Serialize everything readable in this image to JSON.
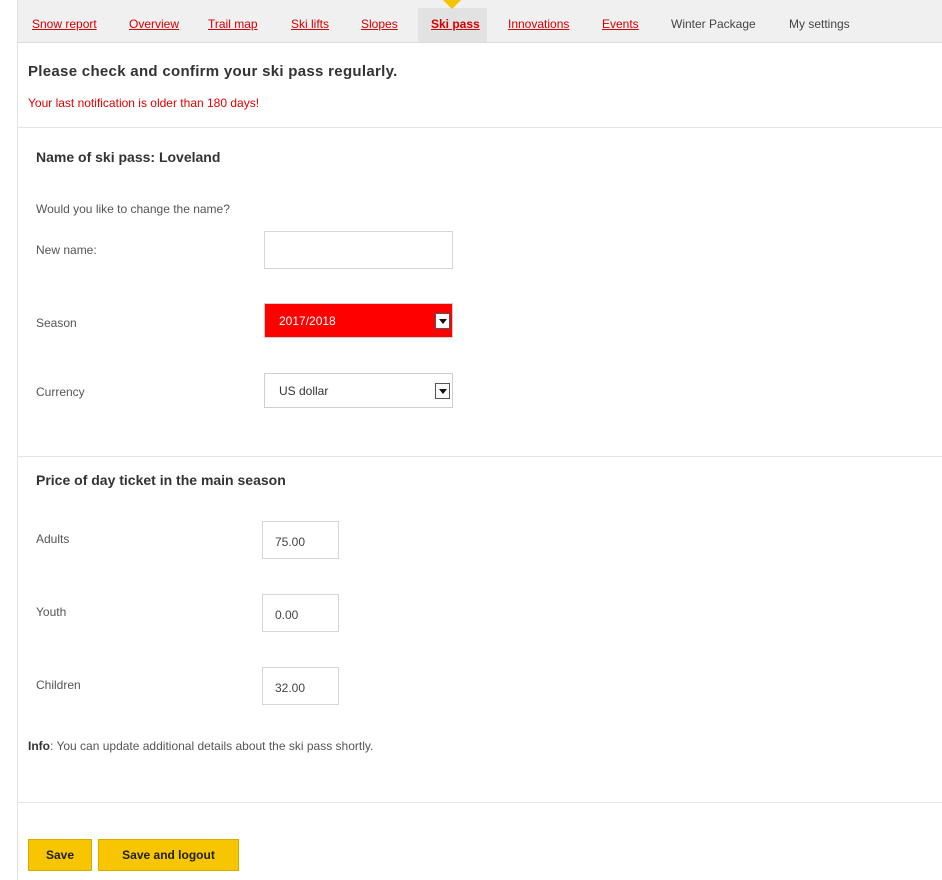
{
  "nav": {
    "tabs": [
      {
        "label": "Snow report"
      },
      {
        "label": "Overview"
      },
      {
        "label": "Trail map"
      },
      {
        "label": "Ski lifts"
      },
      {
        "label": "Slopes"
      },
      {
        "label": "Ski pass"
      },
      {
        "label": "Innovations"
      },
      {
        "label": "Events"
      },
      {
        "label": "Winter Package"
      },
      {
        "label": "My settings"
      }
    ],
    "active": "Ski pass"
  },
  "page": {
    "heading": "Please check and confirm your ski pass regularly.",
    "warning": "Your last notification is older than 180 days!"
  },
  "pass_section": {
    "title": "Name of ski pass: Loveland",
    "change_prompt": "Would you like to change the name?",
    "new_name_label": "New name:",
    "new_name_value": "",
    "season_label": "Season",
    "season_value": "2017/2018",
    "currency_label": "Currency",
    "currency_value": "US dollar"
  },
  "price_section": {
    "title": "Price of day ticket in the main season",
    "adults_label": "Adults",
    "adults_value": "75.00",
    "youth_label": "Youth",
    "youth_value": "0.00",
    "children_label": "Children",
    "children_value": "32.00"
  },
  "info": {
    "prefix": "Info",
    "text": ": You can update additional details about the ski pass shortly."
  },
  "actions": {
    "save_label": "Save",
    "save_logout_label": "Save and logout"
  },
  "colors": {
    "accent": "#f7c600",
    "link": "#d40000",
    "season_bg": "#ff0000"
  }
}
